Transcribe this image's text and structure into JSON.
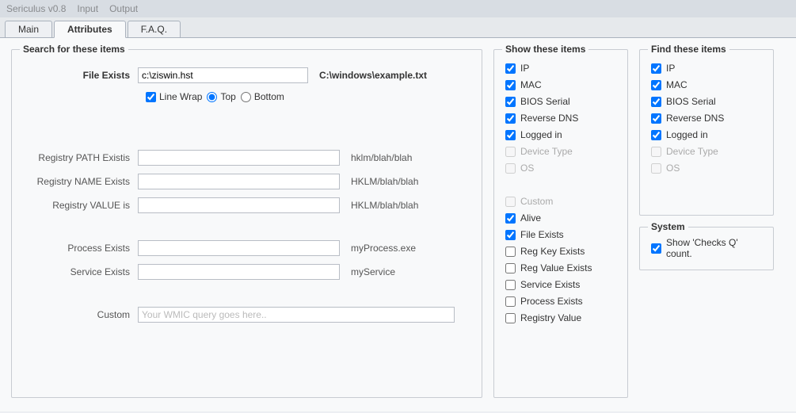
{
  "menu": {
    "title": "Sericulus v0.8",
    "input": "Input",
    "output": "Output"
  },
  "tabs": {
    "main": "Main",
    "attributes": "Attributes",
    "faq": "F.A.Q."
  },
  "search": {
    "legend": "Search for these items",
    "file_exists_label": "File Exists",
    "file_exists_value": "c:\\ziswin.hst",
    "file_exists_hint": "C:\\windows\\example.txt",
    "line_wrap": "Line Wrap",
    "top": "Top",
    "bottom": "Bottom",
    "reg_path_label": "Registry PATH Existis",
    "reg_path_hint": "hklm/blah/blah",
    "reg_name_label": "Registry NAME Exists",
    "reg_name_hint": "HKLM/blah/blah",
    "reg_value_label": "Registry VALUE is",
    "reg_value_hint": "HKLM/blah/blah",
    "process_label": "Process Exists",
    "process_hint": "myProcess.exe",
    "service_label": "Service Exists",
    "service_hint": "myService",
    "custom_label": "Custom",
    "custom_placeholder": "Your WMIC query goes here.."
  },
  "show": {
    "legend": "Show these items",
    "items": [
      {
        "label": "IP",
        "checked": true,
        "disabled": false
      },
      {
        "label": "MAC",
        "checked": true,
        "disabled": false
      },
      {
        "label": "BIOS Serial",
        "checked": true,
        "disabled": false
      },
      {
        "label": "Reverse DNS",
        "checked": true,
        "disabled": false
      },
      {
        "label": "Logged in",
        "checked": true,
        "disabled": false
      },
      {
        "label": "Device Type",
        "checked": false,
        "disabled": true
      },
      {
        "label": "OS",
        "checked": false,
        "disabled": true
      }
    ],
    "items2": [
      {
        "label": "Custom",
        "checked": false,
        "disabled": true
      },
      {
        "label": "Alive",
        "checked": true,
        "disabled": false
      },
      {
        "label": "File Exists",
        "checked": true,
        "disabled": false
      },
      {
        "label": "Reg Key Exists",
        "checked": false,
        "disabled": false
      },
      {
        "label": "Reg Value Exists",
        "checked": false,
        "disabled": false
      },
      {
        "label": "Service Exists",
        "checked": false,
        "disabled": false
      },
      {
        "label": "Process Exists",
        "checked": false,
        "disabled": false
      },
      {
        "label": "Registry Value",
        "checked": false,
        "disabled": false
      }
    ]
  },
  "find": {
    "legend": "Find these items",
    "items": [
      {
        "label": "IP",
        "checked": true,
        "disabled": false
      },
      {
        "label": "MAC",
        "checked": true,
        "disabled": false
      },
      {
        "label": "BIOS Serial",
        "checked": true,
        "disabled": false
      },
      {
        "label": "Reverse DNS",
        "checked": true,
        "disabled": false
      },
      {
        "label": "Logged in",
        "checked": true,
        "disabled": false
      },
      {
        "label": "Device Type",
        "checked": false,
        "disabled": true
      },
      {
        "label": "OS",
        "checked": false,
        "disabled": true
      }
    ]
  },
  "system": {
    "legend": "System",
    "show_checks": "Show 'Checks Q' count."
  }
}
